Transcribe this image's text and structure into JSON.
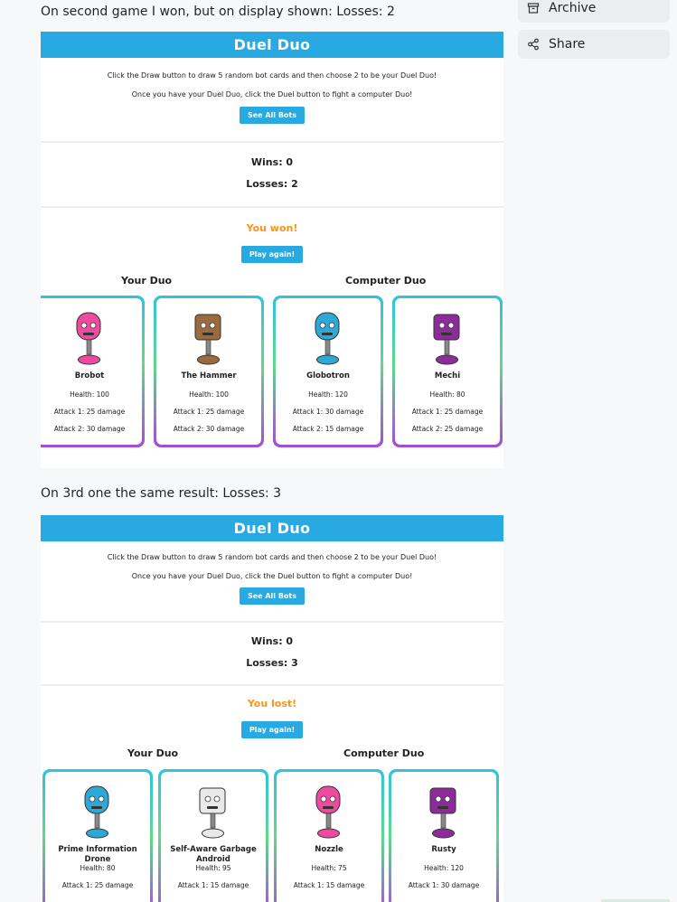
{
  "post": {
    "line1": "On second game I won, but on display shown: Losses: 2",
    "line2": "On 3rd one the same result: Losses: 3"
  },
  "sidebar": {
    "archive_label": "Archive",
    "share_label": "Share"
  },
  "game1": {
    "title": "Duel Duo",
    "intro1": "Click the Draw button to draw 5 random bot cards and then choose 2 to be your Duel Duo!",
    "intro2": "Once you have your Duel Duo, click the Duel button to fight a computer Duo!",
    "see_all_label": "See All Bots",
    "wins": "Wins: 0",
    "losses": "Losses: 2",
    "result": "You won!",
    "play_again_label": "Play again!",
    "your_duo": "Your Duo",
    "computer_duo": "Computer Duo",
    "cards": [
      {
        "name": "Brobot",
        "health": "Health: 100",
        "attack1": "Attack 1: 25 damage",
        "attack2": "Attack 2: 30 damage",
        "color": "#f04aa0",
        "icon": "robot-icon"
      },
      {
        "name": "The Hammer",
        "health": "Health: 100",
        "attack1": "Attack 1: 25 damage",
        "attack2": "Attack 2: 30 damage",
        "color": "#9b6a3d",
        "icon": "robot-icon"
      },
      {
        "name": "Globotron",
        "health": "Health: 120",
        "attack1": "Attack 1: 30 damage",
        "attack2": "Attack 2: 15 damage",
        "color": "#2ea8d6",
        "icon": "robot-icon"
      },
      {
        "name": "Mechi",
        "health": "Health: 80",
        "attack1": "Attack 1: 25 damage",
        "attack2": "Attack 2: 25 damage",
        "color": "#8e2b9b",
        "icon": "robot-icon"
      }
    ]
  },
  "game2": {
    "title": "Duel Duo",
    "intro1": "Click the Draw button to draw 5 random bot cards and then choose 2 to be your Duel Duo!",
    "intro2": "Once you have your Duel Duo, click the Duel button to fight a computer Duo!",
    "see_all_label": "See All Bots",
    "wins": "Wins: 0",
    "losses": "Losses: 3",
    "result": "You lost!",
    "play_again_label": "Play again!",
    "your_duo": "Your Duo",
    "computer_duo": "Computer Duo",
    "cards": [
      {
        "name": "Prime Information Drone",
        "health": "Health: 80",
        "attack1": "Attack 1: 25 damage",
        "color": "#2ea8d6",
        "icon": "robot-icon"
      },
      {
        "name": "Self-Aware Garbage Android",
        "health": "Health: 95",
        "attack1": "Attack 1: 15 damage",
        "color": "#e9e9e9",
        "icon": "robot-icon"
      },
      {
        "name": "Nozzle",
        "health": "Health: 75",
        "attack1": "Attack 1: 15 damage",
        "color": "#f04aa0",
        "icon": "robot-icon"
      },
      {
        "name": "Rusty",
        "health": "Health: 120",
        "attack1": "Attack 1: 30 damage",
        "color": "#8e2b9b",
        "icon": "robot-icon"
      }
    ]
  }
}
